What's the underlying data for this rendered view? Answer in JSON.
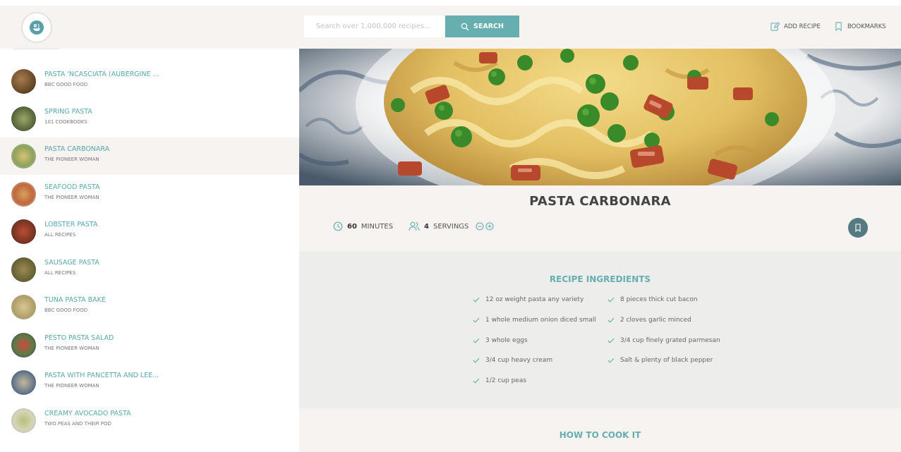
{
  "header": {
    "logo_icon": "forkify-logo-icon",
    "search_placeholder": "Search over 1,000,000 recipes...",
    "search_button": "SEARCH",
    "add_recipe": "ADD RECIPE",
    "bookmarks": "BOOKMARKS"
  },
  "sidebar": {
    "items": [
      {
        "title": "PASTA 'NCASCIATA (AUBERGINE ...",
        "publisher": "BBC GOOD FOOD",
        "active": false
      },
      {
        "title": "SPRING PASTA",
        "publisher": "101 COOKBOOKS",
        "active": false
      },
      {
        "title": "PASTA CARBONARA",
        "publisher": "THE PIONEER WOMAN",
        "active": true
      },
      {
        "title": "SEAFOOD PASTA",
        "publisher": "THE PIONEER WOMAN",
        "active": false
      },
      {
        "title": "LOBSTER PASTA",
        "publisher": "ALL RECIPES",
        "active": false
      },
      {
        "title": "SAUSAGE PASTA",
        "publisher": "ALL RECIPES",
        "active": false
      },
      {
        "title": "TUNA PASTA BAKE",
        "publisher": "BBC GOOD FOOD",
        "active": false
      },
      {
        "title": "PESTO PASTA SALAD",
        "publisher": "THE PIONEER WOMAN",
        "active": false
      },
      {
        "title": "PASTA WITH PANCETTA AND LEE...",
        "publisher": "THE PIONEER WOMAN",
        "active": false
      },
      {
        "title": "CREAMY AVOCADO PASTA",
        "publisher": "TWO PEAS AND THEIR POD",
        "active": false
      }
    ]
  },
  "recipe": {
    "title": "PASTA CARBONARA",
    "minutes_value": "60",
    "minutes_label": "MINUTES",
    "servings_value": "4",
    "servings_label": "SERVINGS",
    "ingredients_title": "RECIPE INGREDIENTS",
    "ingredients": [
      "12 oz weight pasta any variety",
      "8 pieces thick cut bacon",
      "1 whole medium onion diced small",
      "2 cloves garlic minced",
      "3 whole eggs",
      "3/4 cup finely grated parmesan",
      "3/4 cup heavy cream",
      "Salt & plenty of black pepper",
      "1/2 cup peas"
    ],
    "howto_title": "HOW TO COOK IT"
  },
  "colors": {
    "accent": "#66aeaf",
    "background": "#f6f3f1",
    "bookmark_button": "#567a82"
  }
}
